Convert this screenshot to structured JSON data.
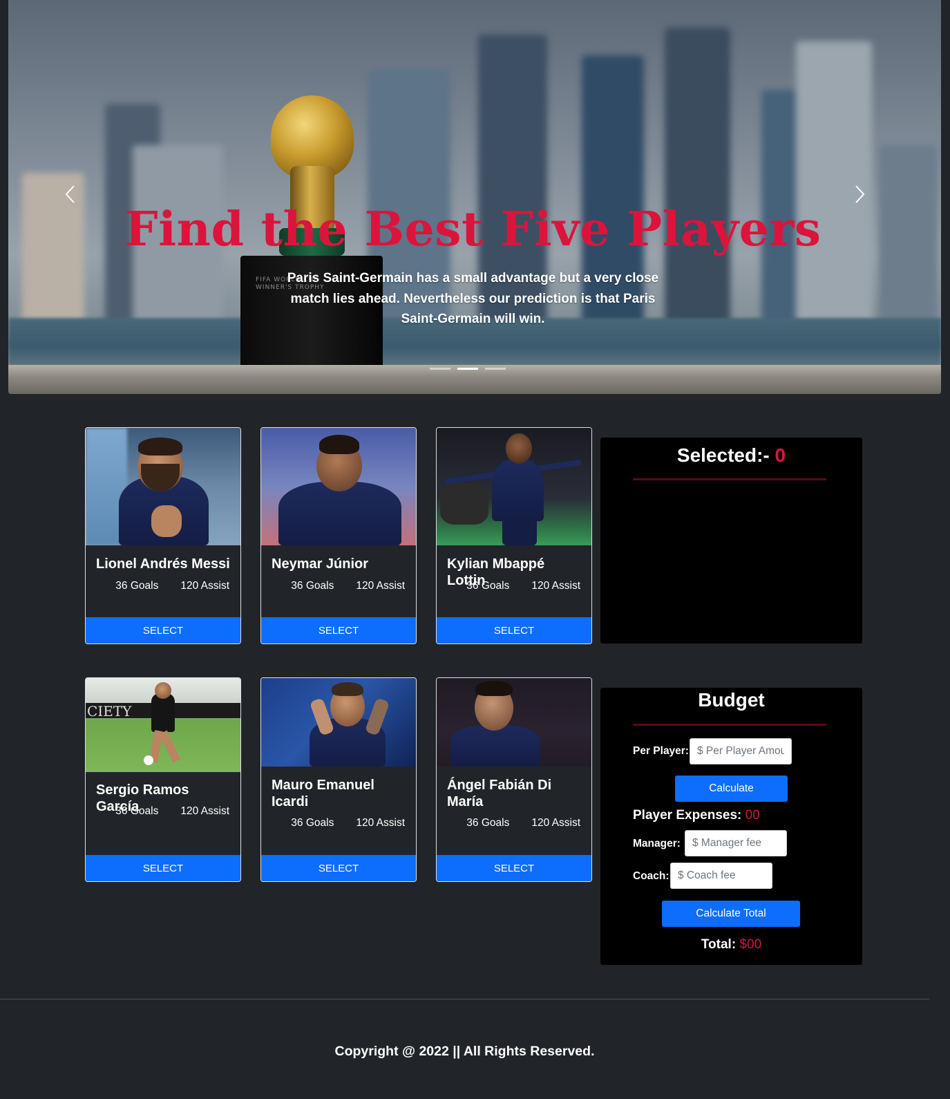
{
  "hero": {
    "title": "Find the Best Five Players",
    "subtitle": "Paris Saint-Germain has a small advantage but a very close match lies ahead. Nevertheless our prediction is that Paris Saint-Germain will win.",
    "trophy_plate": "FIFA WORLD CUP\nWINNER'S TROPHY",
    "indicators": 3,
    "active_indicator": 2
  },
  "players": [
    {
      "name": "Lionel Andrés Messi",
      "goals": "36 Goals",
      "assist": "120 Assist",
      "button": "SELECT"
    },
    {
      "name": "Neymar Júnior",
      "goals": "36 Goals",
      "assist": "120 Assist",
      "button": "SELECT"
    },
    {
      "name": "Kylian Mbappé Lottin",
      "goals": "36 Goals",
      "assist": "120 Assist",
      "button": "SELECT"
    },
    {
      "name": "Sergio Ramos García",
      "goals": "36 Goals",
      "assist": "120 Assist",
      "button": "SELECT"
    },
    {
      "name": "Mauro Emanuel Icardi",
      "goals": "36 Goals",
      "assist": "120 Assist",
      "button": "SELECT"
    },
    {
      "name": "Ángel Fabián Di María",
      "goals": "36 Goals",
      "assist": "120 Assist",
      "button": "SELECT"
    }
  ],
  "selected": {
    "label": "Selected:-",
    "count": "0"
  },
  "budget": {
    "title": "Budget",
    "per_player_label": "Per Player:",
    "per_player_placeholder": "$ Per Player Amount",
    "calculate_label": "Calculate",
    "player_expenses_label": "Player Expenses:",
    "player_expenses_value": "00",
    "manager_label": "Manager:",
    "manager_placeholder": "$ Manager fee",
    "coach_label": "Coach:",
    "coach_placeholder": "$ Coach fee",
    "calculate_total_label": "Calculate Total",
    "total_label": "Total:",
    "total_value": "$00"
  },
  "footer": {
    "copyright": "Copyright @ 2022 || All Rights Reserved."
  },
  "colors": {
    "accent_red": "#dc143c",
    "button_blue": "#0d6efd",
    "page_bg": "#212529",
    "panel_bg": "#000000"
  }
}
